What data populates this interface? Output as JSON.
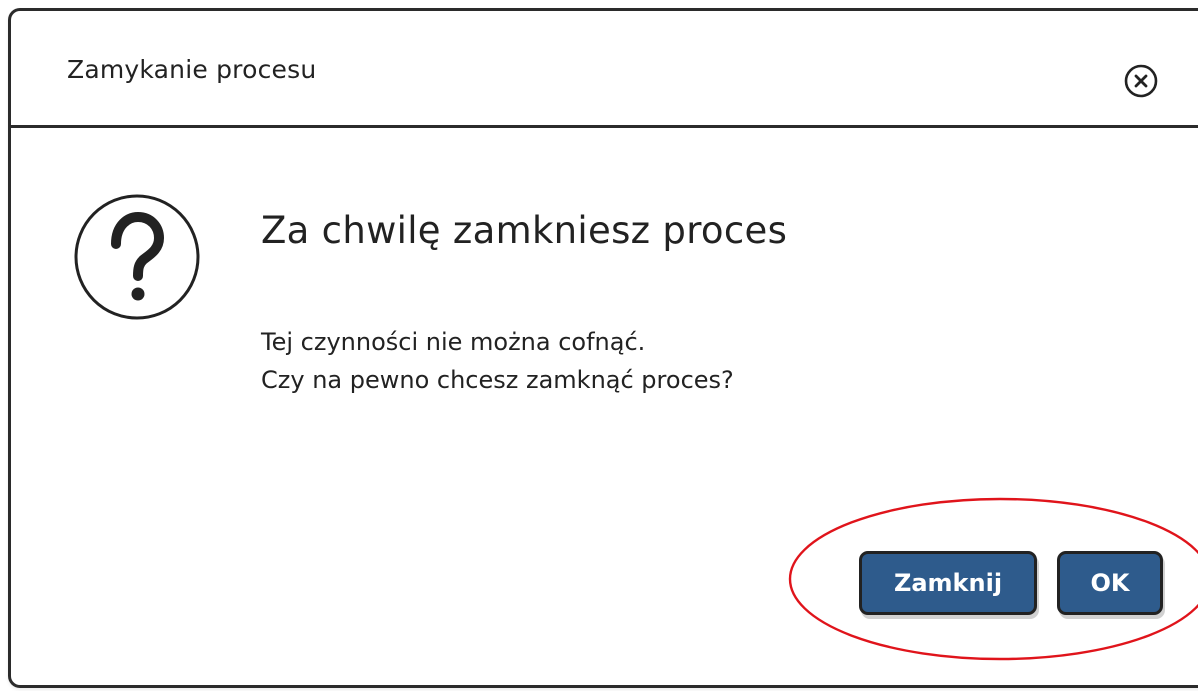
{
  "dialog": {
    "title": "Zamykanie procesu",
    "heading": "Za chwilę zamkniesz proces",
    "message_lines": [
      "Tej czynności nie można cofnąć.",
      "Czy na pewno chcesz zamknąć proces?"
    ],
    "icons": {
      "close": "close-circle-icon",
      "question": "question-icon"
    },
    "buttons": {
      "close_label": "Zamknij",
      "ok_label": "OK"
    },
    "colors": {
      "button_bg": "#2e5b8c",
      "annotation": "#e0141b"
    }
  }
}
